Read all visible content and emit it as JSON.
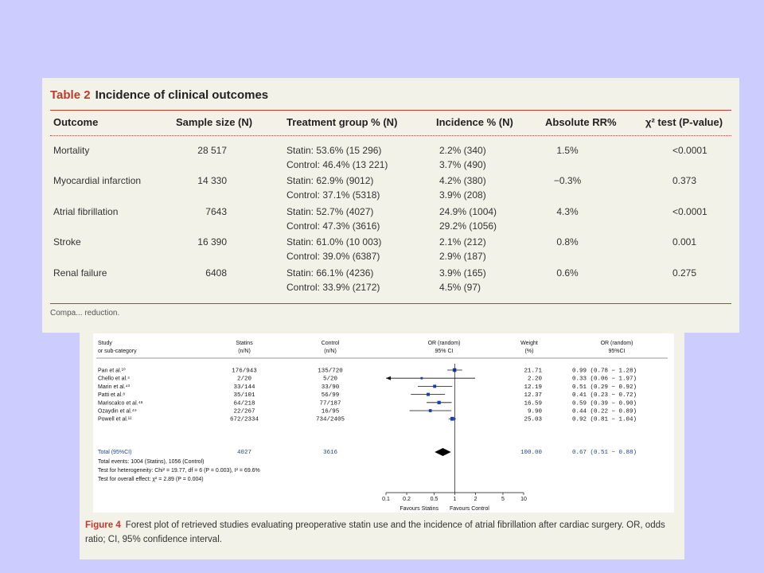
{
  "table": {
    "label": "Table 2",
    "title": "Incidence of clinical outcomes",
    "headers": [
      "Outcome",
      "Sample size (N)",
      "Treatment group % (N)",
      "Incidence % (N)",
      "Absolute RR%",
      "χ² test (P-value)"
    ],
    "rows": [
      {
        "outcome": "Mortality",
        "sample": "28 517",
        "treat1": "Statin: 53.6% (15 296)",
        "treat2": "Control: 46.4% (13 221)",
        "inc1": "2.2% (340)",
        "inc2": "3.7% (490)",
        "arr": "1.5%",
        "p": "<0.0001"
      },
      {
        "outcome": "Myocardial infarction",
        "sample": "14 330",
        "treat1": "Statin: 62.9% (9012)",
        "treat2": "Control: 37.1% (5318)",
        "inc1": "4.2% (380)",
        "inc2": "3.9% (208)",
        "arr": "−0.3%",
        "p": "0.373"
      },
      {
        "outcome": "Atrial fibrillation",
        "sample": "7643",
        "treat1": "Statin: 52.7% (4027)",
        "treat2": "Control: 47.3% (3616)",
        "inc1": "24.9% (1004)",
        "inc2": "29.2% (1056)",
        "arr": "4.3%",
        "p": "<0.0001"
      },
      {
        "outcome": "Stroke",
        "sample": "16 390",
        "treat1": "Statin: 61.0% (10 003)",
        "treat2": "Control: 39.0% (6387)",
        "inc1": "2.1% (212)",
        "inc2": "2.9% (187)",
        "arr": "0.8%",
        "p": "0.001"
      },
      {
        "outcome": "Renal failure",
        "sample": "6408",
        "treat1": "Statin: 66.1% (4236)",
        "treat2": "Control: 33.9% (2172)",
        "inc1": "3.9% (165)",
        "inc2": "4.5% (97)",
        "arr": "0.6%",
        "p": "0.275"
      }
    ],
    "caption_fragment": "Compa... reduction."
  },
  "figure": {
    "label": "Figure 4",
    "caption": "Forest plot of retrieved studies evaluating preoperative statin use and the incidence of atrial fibrillation after cardiac surgery. OR, odds ratio; CI, 95% confidence interval.",
    "col_headers": {
      "study": [
        "Study",
        "or sub-category"
      ],
      "statins": [
        "Statins",
        "(n/N)"
      ],
      "control": [
        "Control",
        "(n/N)"
      ],
      "or": [
        "OR (random)",
        "95% CI"
      ],
      "weight": [
        "Weight",
        "(%)"
      ],
      "orci": [
        "OR (random)",
        "95%CI"
      ]
    },
    "total": {
      "label": "Total (95%CI)",
      "statins": "4027",
      "control": "3616",
      "weight": "100.00",
      "ci_text": "0.67 (0.51 − 0.88)"
    },
    "footnotes": [
      "Total events: 1004 (Statins), 1056 (Control)",
      "Test for heterogeneity: Chi² = 19.77, df = 6 (P = 0.003), I² = 69.6%",
      "Test for overall effect: χ² = 2.89 (P = 0.004)"
    ],
    "axis_ticks": [
      "0.1",
      "0.2",
      "0.5",
      "1",
      "2",
      "5",
      "10"
    ],
    "favours_left": "Favours Statins",
    "favours_right": "Favours Control"
  },
  "chart_data": {
    "type": "scatter",
    "x_scale": "log",
    "xlim": [
      0.1,
      10
    ],
    "ref_line": 1,
    "studies": [
      {
        "name": "Pan et al.¹⁰",
        "statins": "176/943",
        "control": "135/720",
        "weight": "21.71",
        "or": 0.99,
        "lo": 0.78,
        "hi": 1.28,
        "ci_text": "0.99 (0.78 − 1.28)"
      },
      {
        "name": "Chello et al.⁴",
        "statins": "2/20",
        "control": "5/20",
        "weight": "2.20",
        "or": 0.33,
        "lo": 0.06,
        "hi": 1.97,
        "ci_text": "0.33 (0.06 − 1.97)"
      },
      {
        "name": "Marin et al.⁴³",
        "statins": "33/144",
        "control": "33/90",
        "weight": "12.19",
        "or": 0.51,
        "lo": 0.29,
        "hi": 0.92,
        "ci_text": "0.51 (0.29 − 0.92)"
      },
      {
        "name": "Patti et al.⁸",
        "statins": "35/101",
        "control": "56/99",
        "weight": "12.37",
        "or": 0.41,
        "lo": 0.23,
        "hi": 0.72,
        "ci_text": "0.41 (0.23 − 0.72)"
      },
      {
        "name": "Mariscalco et al.⁴⁸",
        "statins": "64/218",
        "control": "77/187",
        "weight": "16.59",
        "or": 0.59,
        "lo": 0.39,
        "hi": 0.9,
        "ci_text": "0.59 (0.39 − 0.90)"
      },
      {
        "name": "Ozaydin et al.⁴⁹",
        "statins": "22/267",
        "control": "16/95",
        "weight": "9.90",
        "or": 0.44,
        "lo": 0.22,
        "hi": 0.89,
        "ci_text": "0.44 (0.22 − 0.89)"
      },
      {
        "name": "Powell et al.¹²",
        "statins": "672/2334",
        "control": "734/2405",
        "weight": "25.03",
        "or": 0.92,
        "lo": 0.81,
        "hi": 1.04,
        "ci_text": "0.92 (0.81 − 1.04)"
      }
    ],
    "pooled": {
      "or": 0.67,
      "lo": 0.51,
      "hi": 0.88
    }
  }
}
